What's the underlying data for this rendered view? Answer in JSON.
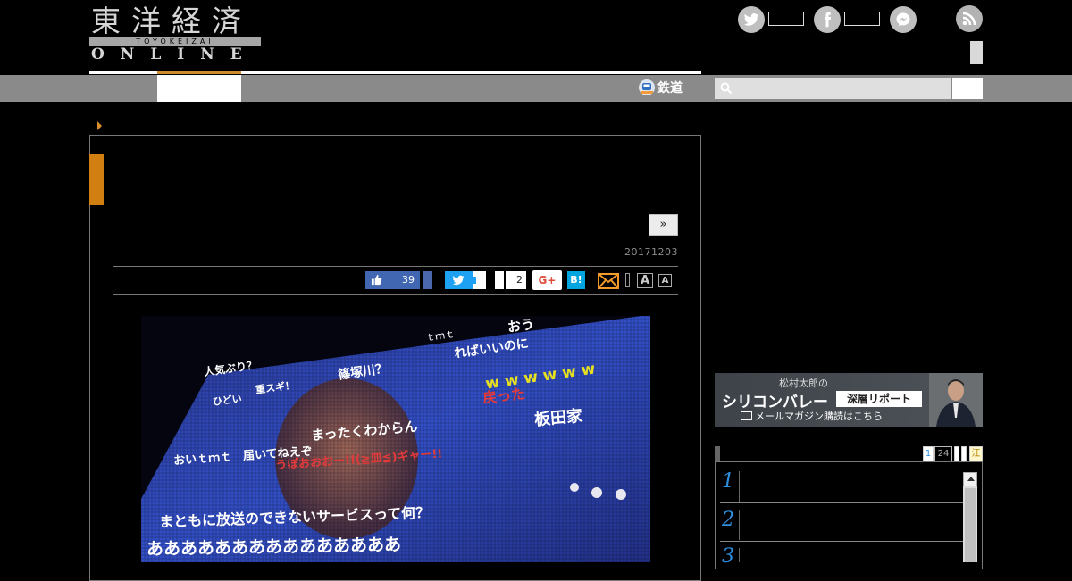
{
  "header": {
    "logo_kanji": "東洋経済",
    "logo_sub": "TOYOKEIZAI",
    "logo_online": "ONLINE",
    "social_icons": [
      "twitter-icon",
      "facebook-icon",
      "messenger-icon",
      "rss-icon"
    ]
  },
  "nav": {
    "rail_label": "鉄道"
  },
  "article": {
    "next_label": "»",
    "date": "20171203",
    "like_count": "39",
    "hatebu_count": "2",
    "gplus_label": "G+",
    "hatena_label": "B!",
    "font_large": "A",
    "font_small": "A"
  },
  "photo_texts": {
    "l1": "人気ぶり？",
    "l2": "ひどい",
    "l3": "重スギ！",
    "l4": "篠塚川？",
    "l5": "ｔｍｔ",
    "l6": "おう",
    "l7": "ればいいのに",
    "l8": "戻った",
    "l9": "板田家",
    "l10": "まったくわからん",
    "l11": "おいｔｍｔ　届いてねえぞ",
    "l12": "まともに放送のできないサービスって何？",
    "l13": "あああああああああああああああ",
    "l14": "うぽおおおー!!(≧皿≦)ギャー!!",
    "l15": "w w w w w w"
  },
  "sidebar": {
    "banner_small": "松村太郎の",
    "banner_title": "シリコンバレー",
    "banner_tag": "深層リポート",
    "banner_sub": "メールマガジン購読はこちら",
    "rank_tabs": [
      "1",
      "24",
      "",
      "",
      "江"
    ],
    "rank_numbers": [
      "1",
      "2",
      "3"
    ]
  },
  "colors": {
    "accent_orange": "#d17f10",
    "facebook_blue": "#4267b2",
    "twitter_blue": "#1da1f2",
    "rank_blue": "#2e8ee0"
  }
}
